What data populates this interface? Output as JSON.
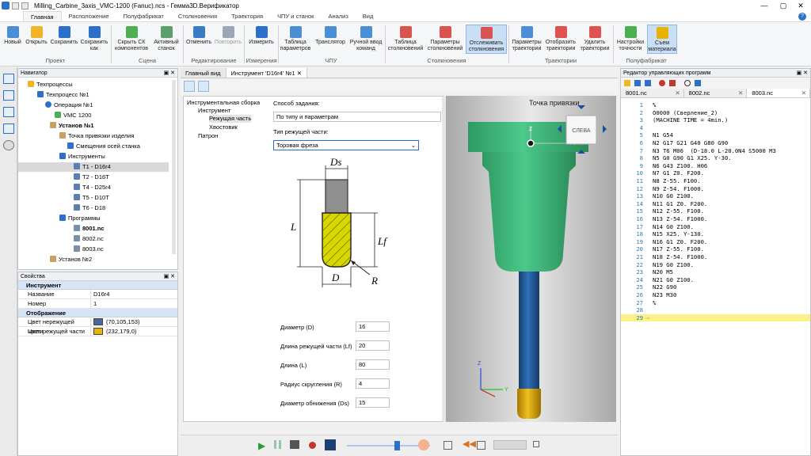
{
  "window": {
    "title": "Milling_Carbine_3axis_VMC-1200 (Fanuc).ncs - Гемма3D.Верификатор",
    "controls": [
      "—",
      "▢",
      "✕"
    ]
  },
  "menu_tabs": [
    "Главная",
    "Расположение",
    "Полуфабрикат",
    "Столкновения",
    "Траектория",
    "ЧПУ и станок",
    "Анализ",
    "Вид"
  ],
  "ribbon": {
    "buttons": [
      "Новый",
      "Открыть",
      "Сохранить",
      "Сохранить как",
      "Скрыть СК компонентов",
      "Активный станок",
      "Отменить",
      "Повторить",
      "Измерить",
      "Таблица параметров",
      "Транслятор",
      "Ручной ввод команд",
      "Таблица столкновений",
      "Параметры столкновений",
      "Отслеживать столкновения",
      "Параметры траектории",
      "Отобразить траектории",
      "Удалить траектории",
      "Настройки точности",
      "Съем материала"
    ],
    "groups": [
      "Проект",
      "Сцена",
      "Редактирование",
      "Измерения",
      "ЧПУ",
      "Столкновения",
      "Траектории",
      "Полуфабрикат"
    ]
  },
  "navigator": {
    "title": "Навигатор",
    "items": [
      "Техпроцессы",
      "Техпроцесс №1",
      "Операция №1",
      "VMC 1200",
      "Установ №1",
      "Точка привязки изделия",
      "Смещения осей станка",
      "Инструменты",
      "T1 - D16r4",
      "T2 - D16T",
      "T4 - D25r4",
      "T5 - D10T",
      "T6 - D18",
      "Программы",
      "8001.nc",
      "8002.nc",
      "8003.nc",
      "Установ №2"
    ]
  },
  "properties": {
    "title": "Свойства",
    "section1": "Инструмент",
    "name_label": "Название",
    "name_value": "D16r4",
    "number_label": "Номер",
    "number_value": "1",
    "section2": "Отображение",
    "noncut_label": "Цвет нережущей части",
    "noncut_value": "(70,105,153)",
    "noncut_color": "#466999",
    "cut_label": "Цвет режущей части",
    "cut_value": "(232,179,0)",
    "cut_color": "#e8b300"
  },
  "doc_tabs": [
    "Главный вид",
    "Инструмент 'D16r4' №1"
  ],
  "tool_tree": [
    "Инструментальная сборка",
    "Инструмент",
    "Режущая часть",
    "Хвостовик",
    "Патрон"
  ],
  "form": {
    "method_label": "Способ задания:",
    "method_value": "По типу и параметрам",
    "type_label": "Тип режущей части:",
    "type_value": "Торовая фреза",
    "sketch": {
      "ds": "Ds",
      "l": "L",
      "lf": "Lf",
      "d": "D",
      "r": "R"
    },
    "params": [
      {
        "label": "Диаметр (D)",
        "value": "16"
      },
      {
        "label": "Длина режущей части (Lf)",
        "value": "20"
      },
      {
        "label": "Длина (L)",
        "value": "80"
      },
      {
        "label": "Радиус скругления (R)",
        "value": "4"
      },
      {
        "label": "Диаметр обнижения (Ds)",
        "value": "15"
      }
    ]
  },
  "view3d": {
    "anchor_label": "Точка привязки",
    "cube_label": "СЛЕВА",
    "axes": {
      "z": "Z",
      "y": "Y"
    }
  },
  "editor": {
    "title": "Редактор управляющих программ",
    "tabs": [
      "8001.nc",
      "8002.nc",
      "8003.nc"
    ],
    "lines": [
      {
        "n": "1",
        "t": "%"
      },
      {
        "n": "2",
        "t": "O0000 (Сверление_2)"
      },
      {
        "n": "3",
        "t": "(MACHINE TIME = 4min.)"
      },
      {
        "n": "4",
        "t": ""
      },
      {
        "n": "5",
        "t": "N1 G54"
      },
      {
        "n": "6",
        "t": "N2 G17 G21 G40 G80 G90"
      },
      {
        "n": "7",
        "t": "N3 T6 M06  (D-18.0 L-20.0N4 S5000 M3"
      },
      {
        "n": "8",
        "t": "N5 G0 G90 G1 X25. Y-30."
      },
      {
        "n": "9",
        "t": "N6 G43 Z100. H06"
      },
      {
        "n": "10",
        "t": "N7 G1 Z0. F200."
      },
      {
        "n": "11",
        "t": "N8 Z-55. F100."
      },
      {
        "n": "12",
        "t": "N9 Z-54. F1000."
      },
      {
        "n": "13",
        "t": "N10 G0 Z100."
      },
      {
        "n": "14",
        "t": "N11 G1 Z0. F200."
      },
      {
        "n": "15",
        "t": "N12 Z-55. F100."
      },
      {
        "n": "16",
        "t": "N13 Z-54. F1000."
      },
      {
        "n": "17",
        "t": "N14 G0 Z100."
      },
      {
        "n": "18",
        "t": "N15 X25. Y-130."
      },
      {
        "n": "19",
        "t": "N16 G1 Z0. F200."
      },
      {
        "n": "20",
        "t": "N17 Z-55. F100."
      },
      {
        "n": "21",
        "t": "N18 Z-54. F1000."
      },
      {
        "n": "22",
        "t": "N19 G0 Z100."
      },
      {
        "n": "23",
        "t": "N20 M5"
      },
      {
        "n": "24",
        "t": "N21 G0 Z100."
      },
      {
        "n": "25",
        "t": "N22 G90"
      },
      {
        "n": "26",
        "t": "N23 M30"
      },
      {
        "n": "27",
        "t": "%"
      },
      {
        "n": "28",
        "t": ""
      },
      {
        "n": "29",
        "t": ""
      }
    ],
    "current_line": 29
  },
  "colors": {
    "accent": "#2c70c9",
    "holder": "#3db37a",
    "shank": "#1f5fa8",
    "cutter": "#e8b300"
  }
}
